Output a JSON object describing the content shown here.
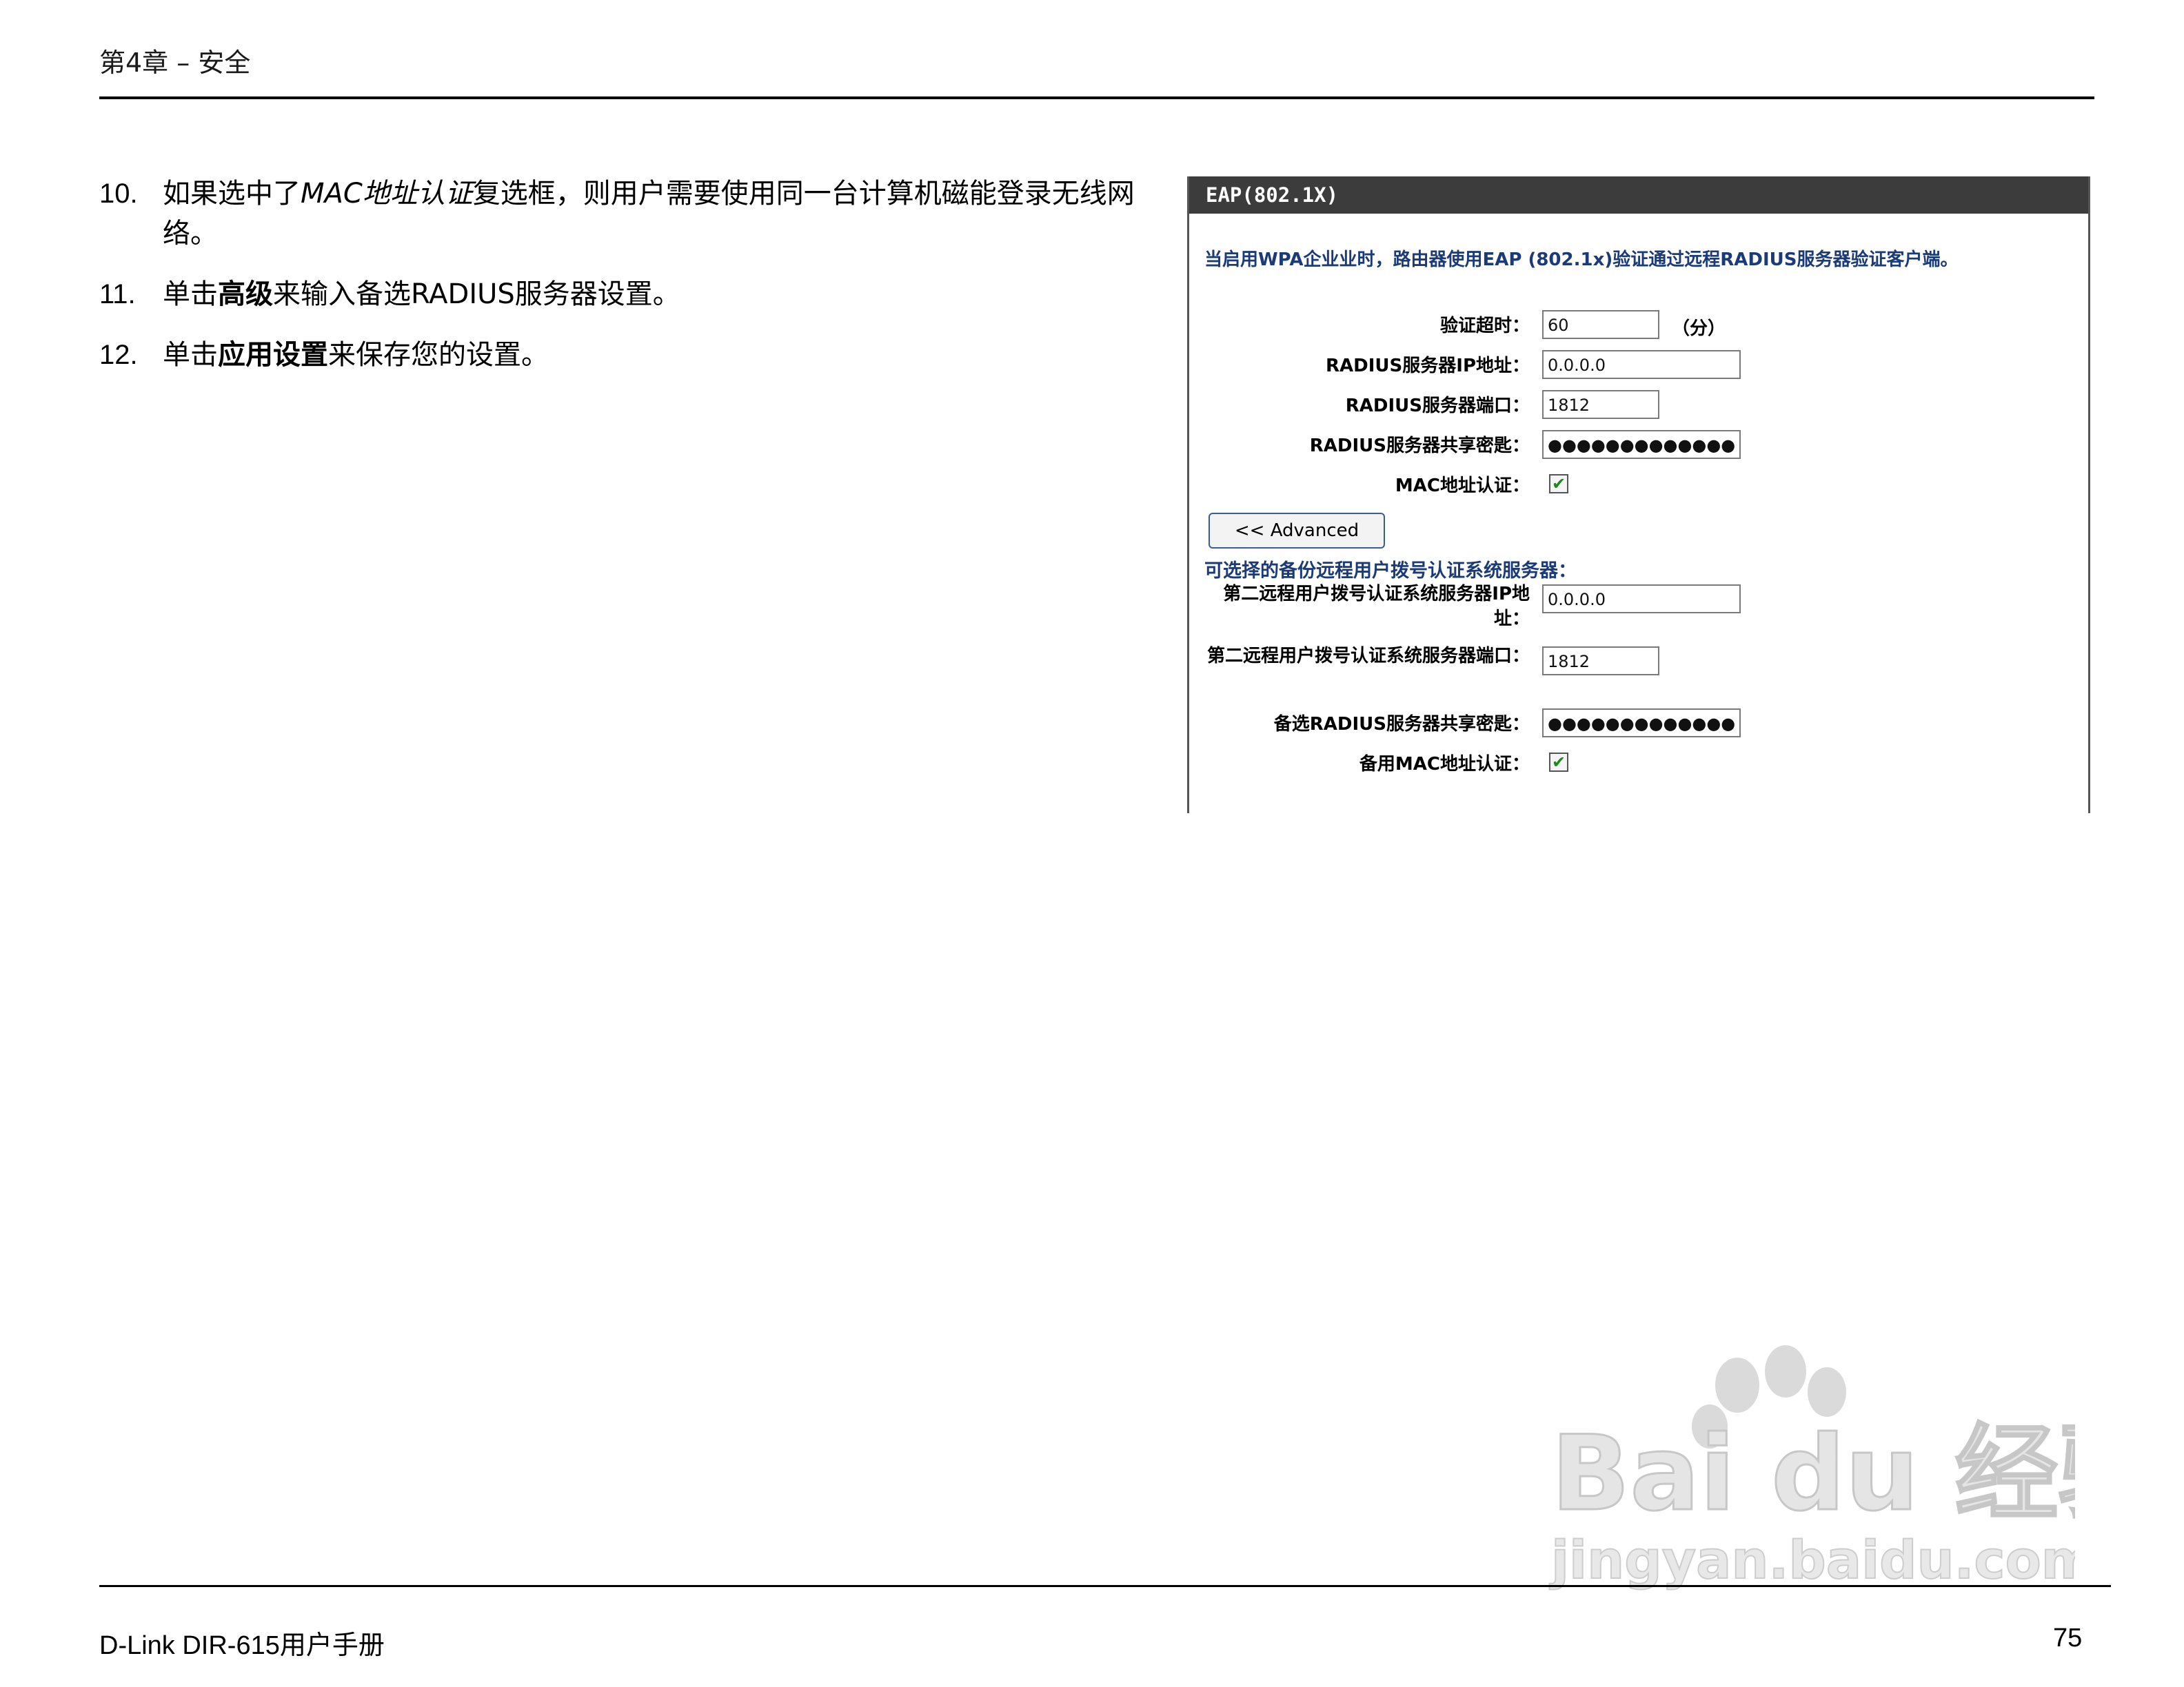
{
  "header": {
    "chapter": "第4章 – 安全"
  },
  "steps": [
    {
      "num": "10.",
      "pre": "如果选中了",
      "em": "MAC地址认证",
      "post": "复选框，则用户需要使用同一台计算机磁能登录无线网络。"
    },
    {
      "num": "11.",
      "pre": "单击",
      "em": "高级",
      "post": "来输入备选RADIUS服务器设置。"
    },
    {
      "num": "12.",
      "pre": "单击",
      "em": "应用设置",
      "post": "来保存您的设置。"
    }
  ],
  "panel": {
    "title": "EAP(802.1X)",
    "description": "当启用WPA企业业时，路由器使用EAP (802.1x)验证通过远程RADIUS服务器验证客户端。",
    "fields": {
      "timeout": {
        "label": "验证超时：",
        "value": "60",
        "unit": "（分）"
      },
      "radius_ip": {
        "label": "RADIUS服务器IP地址：",
        "value": "0.0.0.0"
      },
      "radius_port": {
        "label": "RADIUS服务器端口：",
        "value": "1812"
      },
      "radius_secret": {
        "label": "RADIUS服务器共享密匙：",
        "value": "●●●●●●●●●●●●●"
      },
      "mac_auth": {
        "label": "MAC地址认证：",
        "checked": true,
        "mark": "✔"
      }
    },
    "advanced_button": "<< Advanced",
    "backup_title": "可选择的备份远程用户拨号认证系统服务器：",
    "backup": {
      "ip": {
        "label": "第二远程用户拨号认证系统服务器IP地址：",
        "value": "0.0.0.0"
      },
      "port": {
        "label": "第二远程用户拨号认证系统服务器端口：",
        "value": "1812"
      },
      "secret": {
        "label": "备选RADIUS服务器共享密匙：",
        "value": "●●●●●●●●●●●●●"
      },
      "mac_auth": {
        "label": "备用MAC地址认证：",
        "checked": true,
        "mark": "✔"
      }
    }
  },
  "footer": {
    "left": "D-Link DIR-615用户手册",
    "page": "75"
  },
  "watermark": {
    "brand": "Bai du 经验",
    "url": "jingyan.baidu.com"
  }
}
